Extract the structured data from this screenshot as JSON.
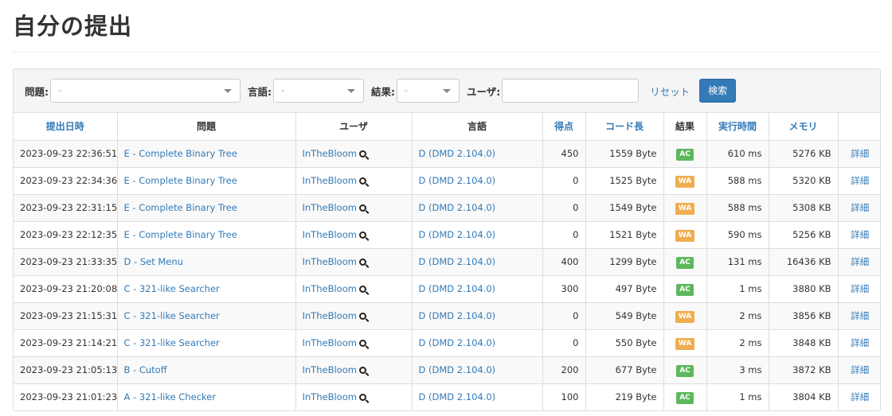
{
  "page": {
    "title": "自分の提出"
  },
  "filters": {
    "problem_label": "問題:",
    "problem_value": "-",
    "language_label": "言語:",
    "language_value": "-",
    "result_label": "結果:",
    "result_value": "-",
    "user_label": "ユーザ:",
    "user_value": "",
    "reset_label": "リセット",
    "search_label": "検索"
  },
  "table": {
    "headers": {
      "submit_time": "提出日時",
      "task": "問題",
      "user": "ユーザ",
      "language": "言語",
      "score": "得点",
      "code_size": "コード長",
      "status": "結果",
      "exec_time": "実行時間",
      "memory": "メモリ",
      "detail": ""
    },
    "status_colors": {
      "AC": "#5cb85c",
      "WA": "#f0ad4e"
    },
    "rows": [
      {
        "time": "2023-09-23 22:36:51",
        "task": "E - Complete Binary Tree",
        "user": "InTheBloom",
        "lang": "D (DMD 2.104.0)",
        "score": "450",
        "size": "1559 Byte",
        "status": "AC",
        "exec": "610 ms",
        "memory": "5276 KB",
        "detail": "詳細"
      },
      {
        "time": "2023-09-23 22:34:36",
        "task": "E - Complete Binary Tree",
        "user": "InTheBloom",
        "lang": "D (DMD 2.104.0)",
        "score": "0",
        "size": "1525 Byte",
        "status": "WA",
        "exec": "588 ms",
        "memory": "5320 KB",
        "detail": "詳細"
      },
      {
        "time": "2023-09-23 22:31:15",
        "task": "E - Complete Binary Tree",
        "user": "InTheBloom",
        "lang": "D (DMD 2.104.0)",
        "score": "0",
        "size": "1549 Byte",
        "status": "WA",
        "exec": "588 ms",
        "memory": "5308 KB",
        "detail": "詳細"
      },
      {
        "time": "2023-09-23 22:12:35",
        "task": "E - Complete Binary Tree",
        "user": "InTheBloom",
        "lang": "D (DMD 2.104.0)",
        "score": "0",
        "size": "1521 Byte",
        "status": "WA",
        "exec": "590 ms",
        "memory": "5256 KB",
        "detail": "詳細"
      },
      {
        "time": "2023-09-23 21:33:35",
        "task": "D - Set Menu",
        "user": "InTheBloom",
        "lang": "D (DMD 2.104.0)",
        "score": "400",
        "size": "1299 Byte",
        "status": "AC",
        "exec": "131 ms",
        "memory": "16436 KB",
        "detail": "詳細"
      },
      {
        "time": "2023-09-23 21:20:08",
        "task": "C - 321-like Searcher",
        "user": "InTheBloom",
        "lang": "D (DMD 2.104.0)",
        "score": "300",
        "size": "497 Byte",
        "status": "AC",
        "exec": "1 ms",
        "memory": "3880 KB",
        "detail": "詳細"
      },
      {
        "time": "2023-09-23 21:15:31",
        "task": "C - 321-like Searcher",
        "user": "InTheBloom",
        "lang": "D (DMD 2.104.0)",
        "score": "0",
        "size": "549 Byte",
        "status": "WA",
        "exec": "2 ms",
        "memory": "3856 KB",
        "detail": "詳細"
      },
      {
        "time": "2023-09-23 21:14:21",
        "task": "C - 321-like Searcher",
        "user": "InTheBloom",
        "lang": "D (DMD 2.104.0)",
        "score": "0",
        "size": "550 Byte",
        "status": "WA",
        "exec": "2 ms",
        "memory": "3848 KB",
        "detail": "詳細"
      },
      {
        "time": "2023-09-23 21:05:13",
        "task": "B - Cutoff",
        "user": "InTheBloom",
        "lang": "D (DMD 2.104.0)",
        "score": "200",
        "size": "677 Byte",
        "status": "AC",
        "exec": "3 ms",
        "memory": "3872 KB",
        "detail": "詳細"
      },
      {
        "time": "2023-09-23 21:01:23",
        "task": "A - 321-like Checker",
        "user": "InTheBloom",
        "lang": "D (DMD 2.104.0)",
        "score": "100",
        "size": "219 Byte",
        "status": "AC",
        "exec": "1 ms",
        "memory": "3804 KB",
        "detail": "詳細"
      }
    ]
  }
}
